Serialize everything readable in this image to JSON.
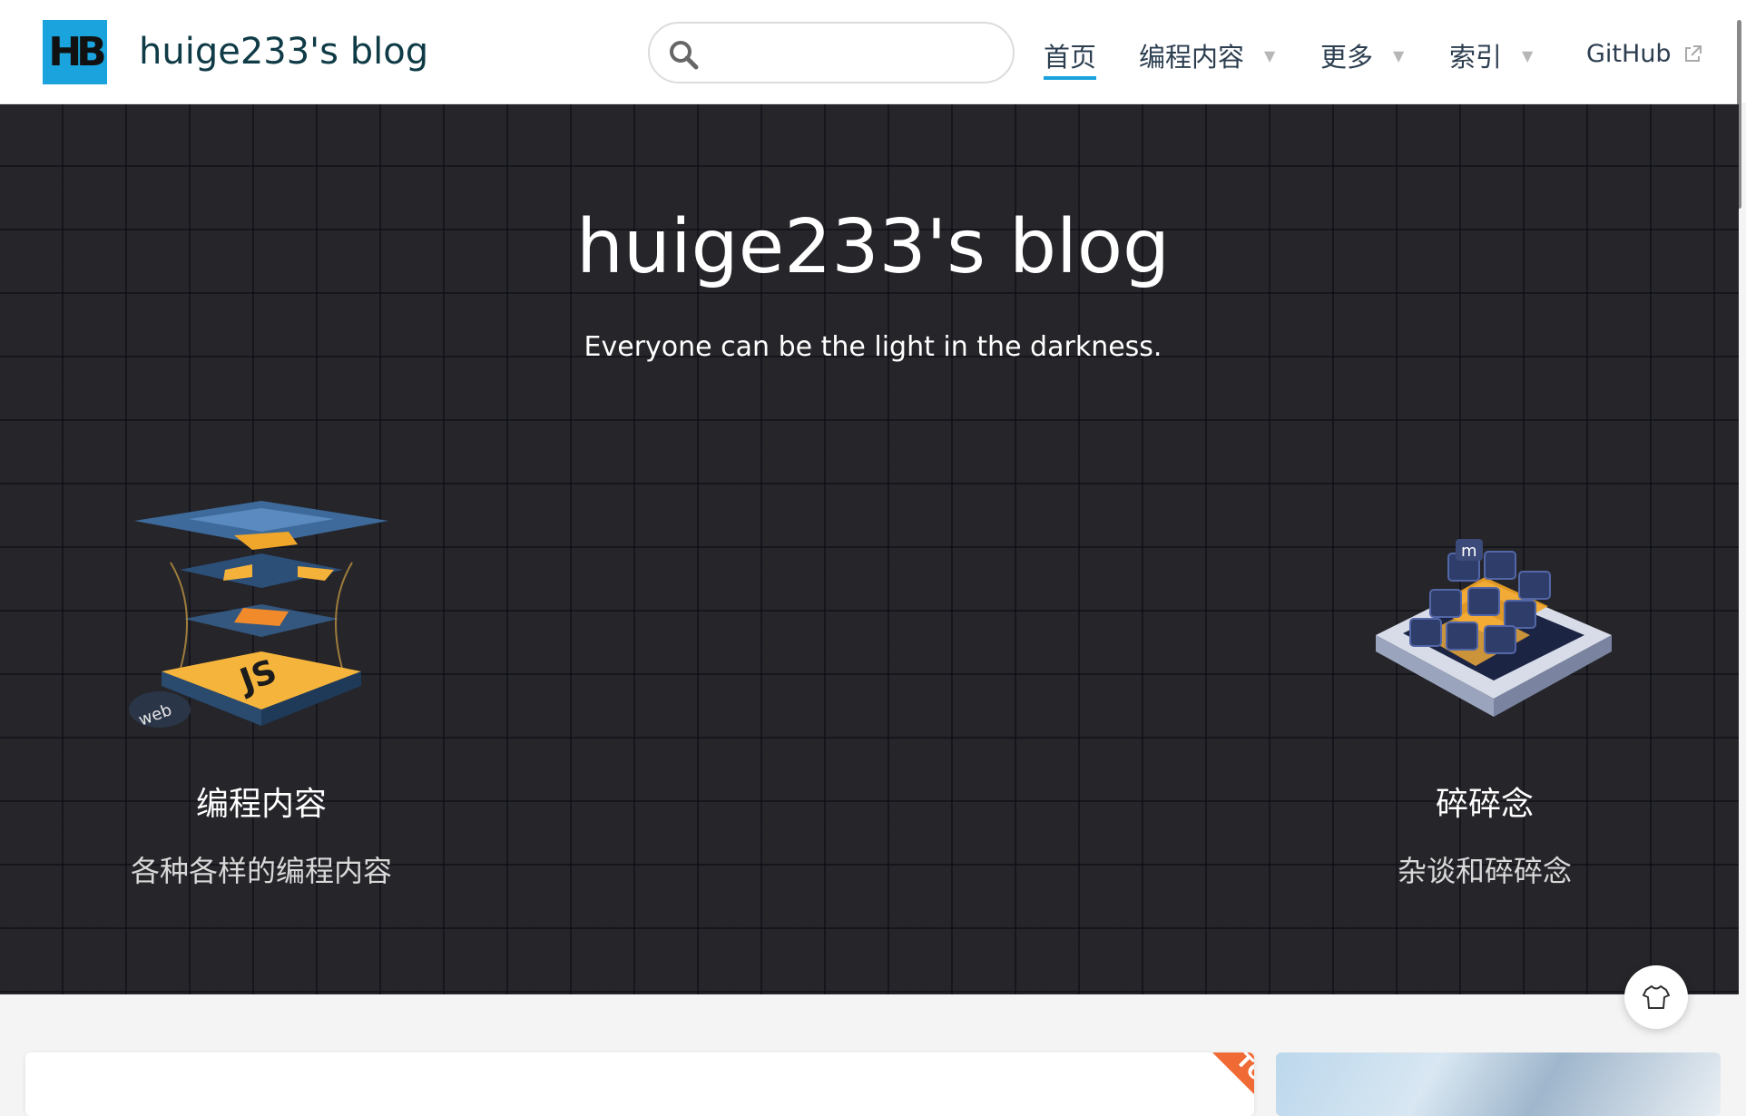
{
  "navbar": {
    "logo_text": "HB",
    "site_name": "huige233's blog",
    "search_placeholder": "",
    "items": [
      {
        "label": "首页",
        "active": true
      },
      {
        "label": "编程内容",
        "dropdown": true
      },
      {
        "label": "更多",
        "dropdown": true
      },
      {
        "label": "索引",
        "dropdown": true
      },
      {
        "label": "GitHub",
        "external": true
      }
    ],
    "accent_color": "#1aa3dc"
  },
  "hero": {
    "title": "huige233's blog",
    "tagline": "Everyone can be the light in the darkness.",
    "features": [
      {
        "title": "编程内容",
        "desc": "各种各样的编程内容",
        "icon": "js-layers-icon",
        "badge": "web"
      },
      {
        "title": "碎碎念",
        "desc": "杂谈和碎碎念",
        "icon": "cube-box-icon"
      }
    ]
  },
  "theme_button": {
    "icon": "tshirt-icon"
  },
  "card": {
    "ribbon": "TOP"
  }
}
